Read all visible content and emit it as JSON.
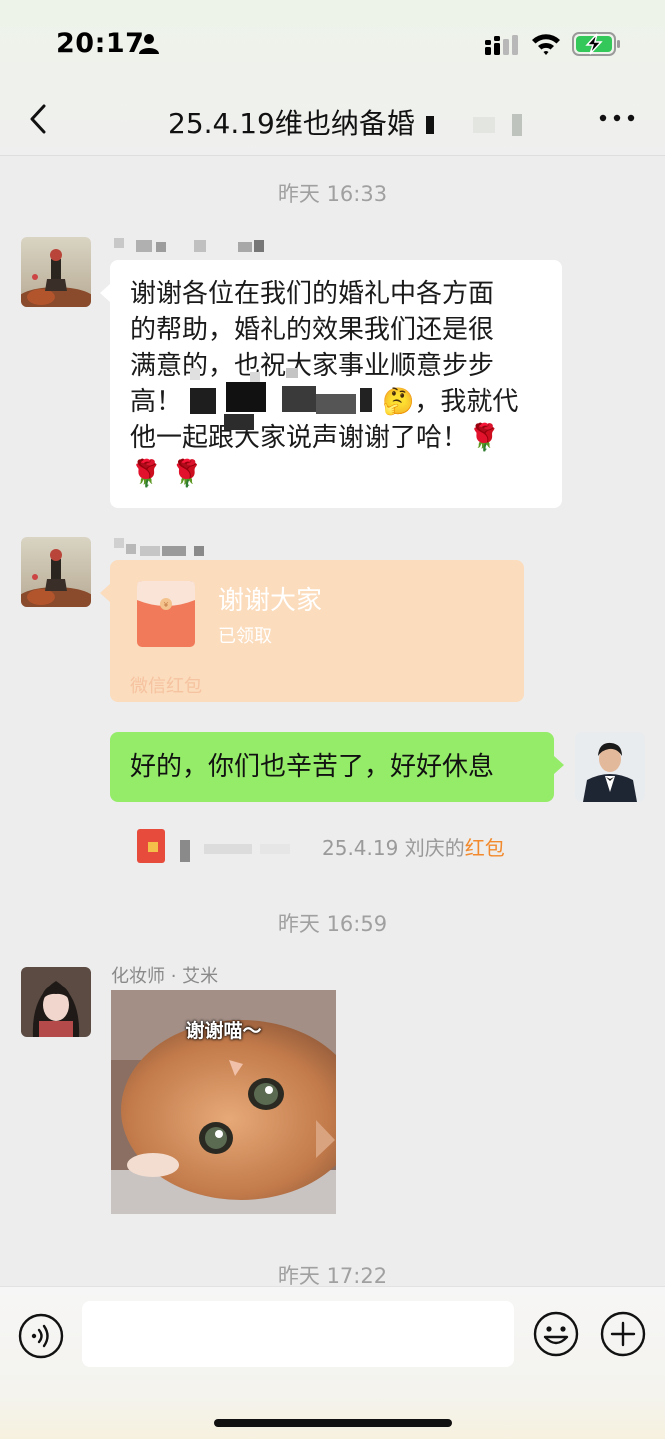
{
  "status_bar": {
    "time": "20:17"
  },
  "header": {
    "title": "25.4.19维也纳备婚"
  },
  "messages": {
    "ts1": "昨天 16:33",
    "msg1": {
      "lines": [
        "谢谢各位在我们的婚礼中各方面",
        "的帮助，婚礼的效果我们还是很",
        "满意的，也祝大家事业顺意步步",
        "高！",
        "他一起跟大家说声谢谢了哈！🌹",
        "🌹 🌹"
      ],
      "line4_tail": "🤔，我就代"
    },
    "redpacket": {
      "title": "谢谢大家",
      "status": "已领取",
      "footer": "微信红包"
    },
    "reply": "好的，你们也辛苦了，好好休息",
    "system": {
      "text": "25.4.19 刘庆的",
      "link": "红包"
    },
    "ts2": "昨天 16:59",
    "sticker_msg": {
      "sender": "化妆师 · 艾米",
      "caption": "谢谢喵～"
    },
    "ts3": "昨天 17:22"
  },
  "input": {
    "value": ""
  },
  "colors": {
    "bubble_self": "#95ec69",
    "bubble_other": "#ffffff",
    "redpacket": "#fbdcbd",
    "background": "#ededed",
    "link": "#f28a2d"
  }
}
